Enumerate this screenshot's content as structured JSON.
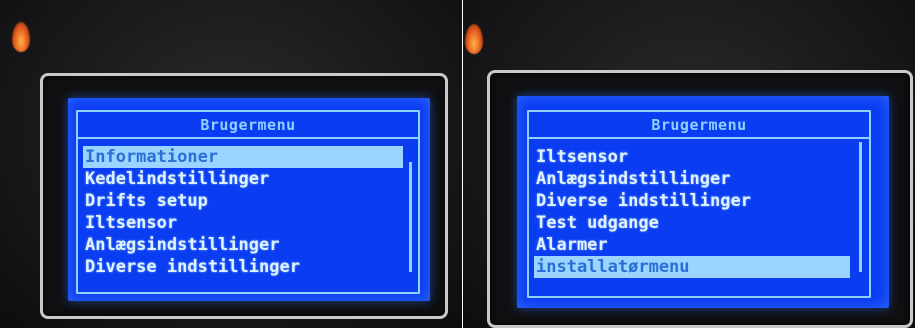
{
  "left_panel": {
    "menu_title": "Brugermenu",
    "items": [
      "Informationer",
      "Kedelindstillinger",
      "Drifts setup",
      "Iltsensor",
      "Anlægsindstillinger",
      "Diverse indstillinger"
    ],
    "selected_item": "Informationer"
  },
  "right_panel": {
    "menu_title": "Brugermenu",
    "items": [
      "Iltsensor",
      "Anlægsindstillinger",
      "Diverse indstillinger",
      "Test udgange",
      "Alarmer",
      "installatørmenu"
    ],
    "selected_item": "installatørmenu"
  },
  "colors": {
    "lcd_background": "#0a3cf2",
    "lcd_text": "#dff2ff",
    "lcd_accent": "#8fd0ff",
    "selection_highlight": "#9ad4ff",
    "bezel": "#c9c9c9",
    "housing": "#1a1a1c",
    "indicator_flame": "#e2541b"
  },
  "icons": {
    "status_indicator": "flame-icon"
  }
}
